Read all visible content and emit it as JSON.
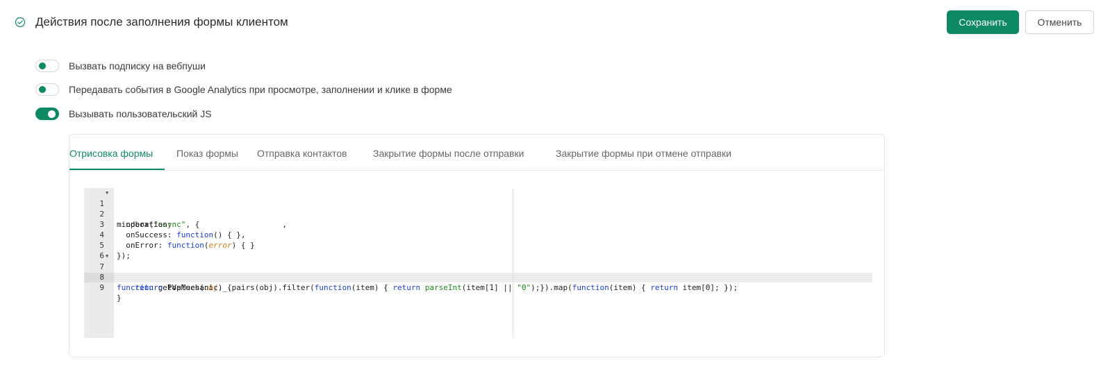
{
  "header": {
    "title": "Действия после заполнения формы клиентом",
    "save_label": "Сохранить",
    "cancel_label": "Отменить",
    "status_icon": "check-circle-icon"
  },
  "toggles": [
    {
      "label": "Вызвать подписку на вебпуши",
      "enabled": false
    },
    {
      "label": "Передавать события в Google Analytics при просмотре, заполнении и клике в форме",
      "enabled": false
    },
    {
      "label": "Вызывать пользовательский JS",
      "enabled": true
    }
  ],
  "tabs": [
    {
      "label": "Отрисовка формы",
      "active": true
    },
    {
      "label": "Показ формы",
      "active": false
    },
    {
      "label": "Отправка контактов",
      "active": false
    },
    {
      "label": "Закрытие формы после отправки",
      "active": false
    },
    {
      "label": "Закрытие формы при отмене отправки",
      "active": false
    }
  ],
  "editor": {
    "line_numbers": [
      "1",
      "2",
      "3",
      "4",
      "5",
      "6",
      "7",
      "8",
      "9"
    ],
    "active_line": "9",
    "lines": [
      "mindbox(\"async\", {",
      "  operation:                        ,",
      "  onSuccess: function() { },",
      "  onError: function(error) { }",
      "});",
      "",
      "function getValues(obj) {",
      "    return PopMechanic._.pairs(obj).filter(function(item) { return parseInt(item[1] || \"0\");}).map(function(item) { return item[0]; });",
      "}"
    ]
  },
  "colors": {
    "accent": "#0d8a63",
    "keyword": "#1a3fd6",
    "string": "#1a8a1a",
    "parameter": "#d07a1a"
  }
}
